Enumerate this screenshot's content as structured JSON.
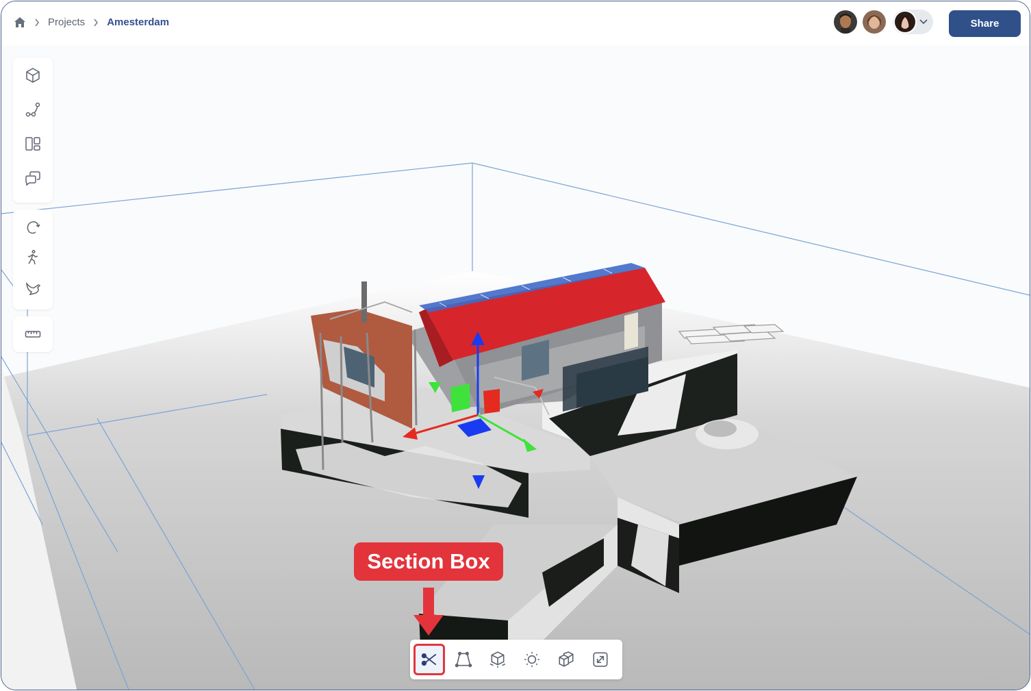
{
  "breadcrumb": {
    "home_icon": "home-icon",
    "items": [
      "Projects",
      "Amesterdam"
    ]
  },
  "header": {
    "share_label": "Share",
    "avatars": [
      "user-avatar-1",
      "user-avatar-2",
      "user-avatar-3"
    ],
    "menu_icon": "chevron-down-icon"
  },
  "left_toolbar": {
    "groups": [
      [
        "cube-icon",
        "path-nodes-icon",
        "layout-panels-icon",
        "comments-icon"
      ],
      [
        "orbit-icon",
        "walk-icon",
        "fly-icon"
      ],
      [
        "ruler-icon"
      ]
    ]
  },
  "bottom_toolbar": {
    "items": [
      "section-box-icon",
      "perspective-icon",
      "explode-model-icon",
      "lighting-icon",
      "materials-icon",
      "fullscreen-icon"
    ],
    "active": "section-box-icon"
  },
  "annotation": {
    "label": "Section Box"
  },
  "colors": {
    "brand": "#30508a",
    "accent": "#e3343c",
    "section_box_lines": "#7aa3d6"
  }
}
